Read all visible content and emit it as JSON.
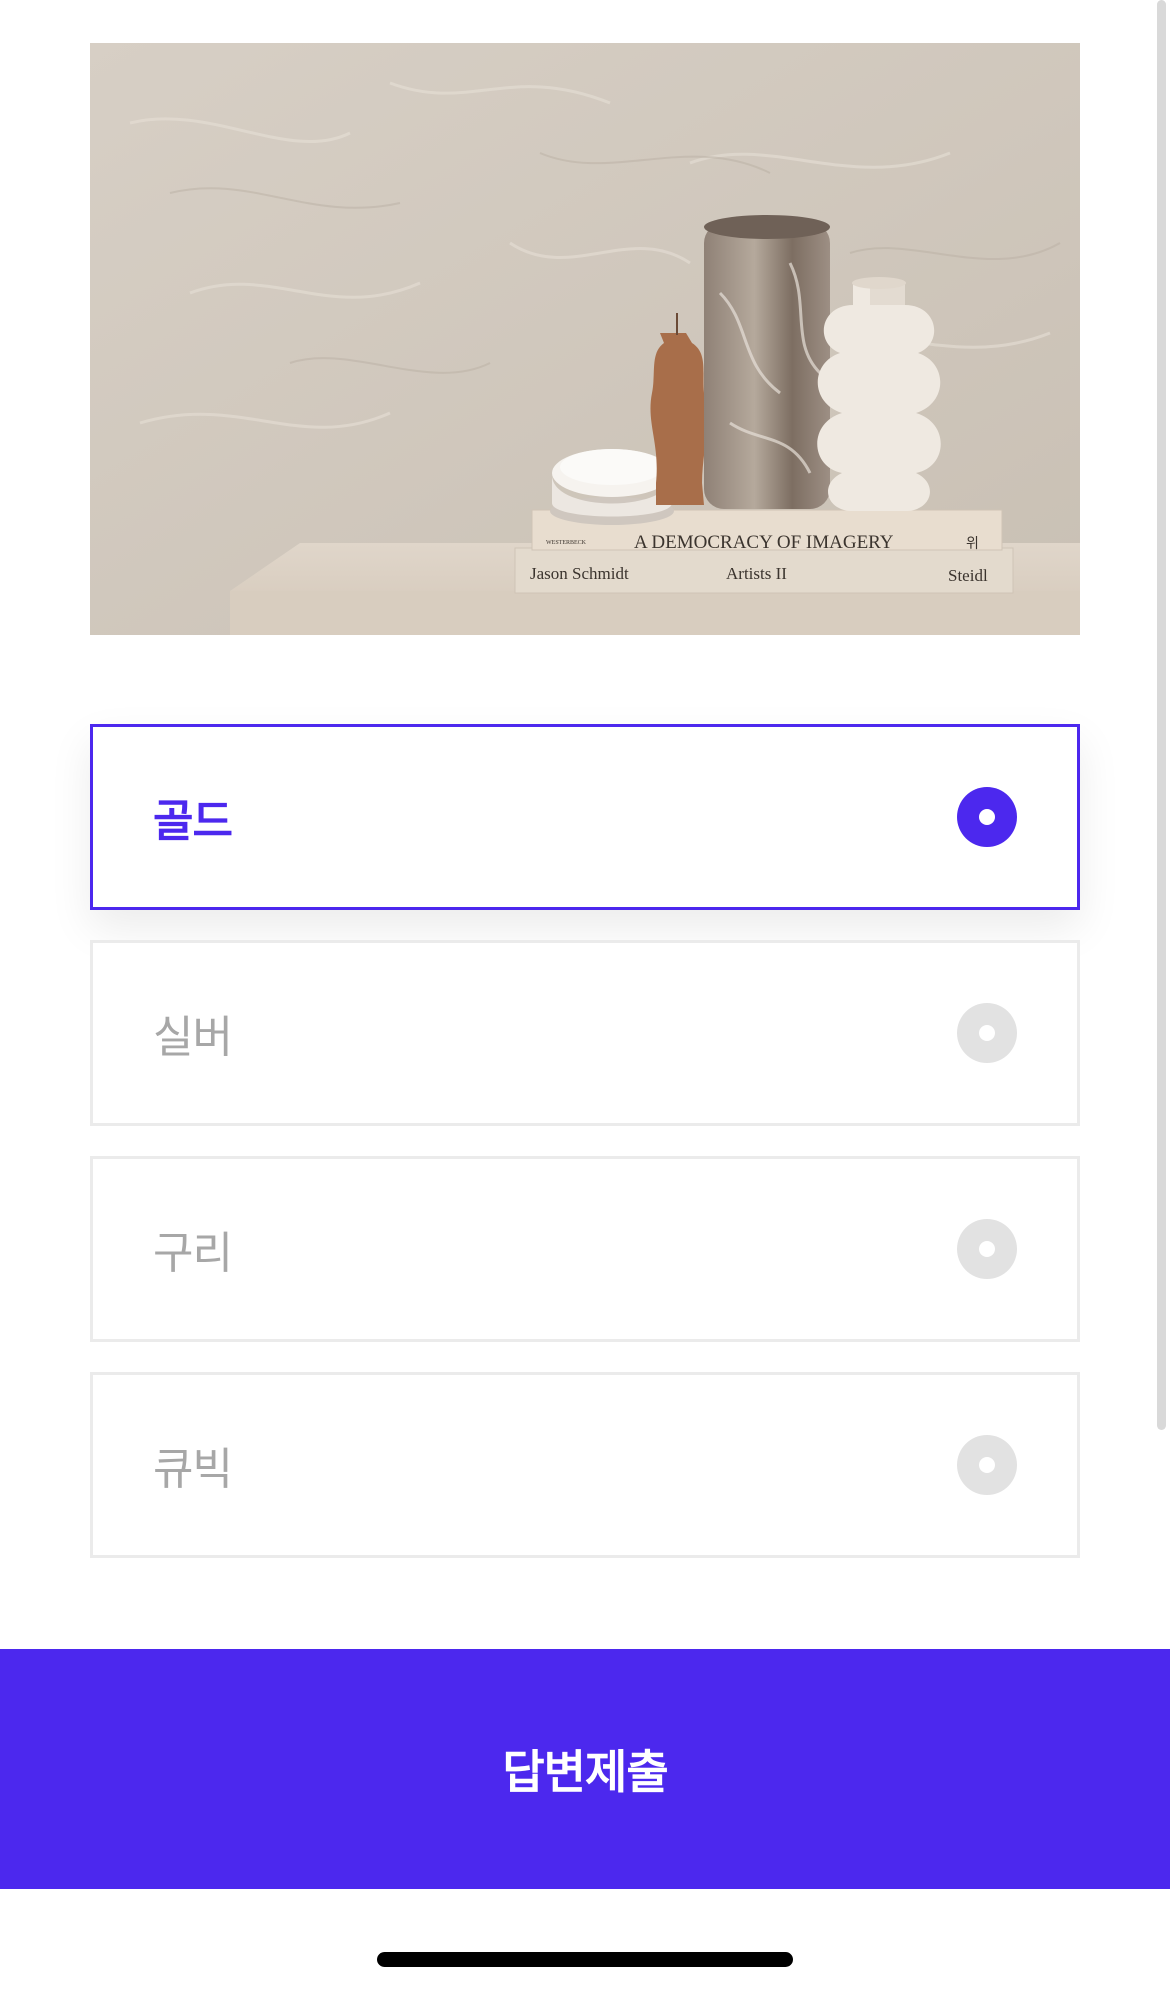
{
  "image": {
    "alt_objects": "book-stack-with-vases",
    "book_top_publisher": "WESTERBECK",
    "book_top_title": "A DEMOCRACY OF IMAGERY",
    "book_top_spine_mark": "위",
    "book_bottom_author": "Jason Schmidt",
    "book_bottom_title": "Artists II",
    "book_bottom_publisher": "Steidl"
  },
  "options": [
    {
      "label": "골드",
      "selected": true
    },
    {
      "label": "실버",
      "selected": false
    },
    {
      "label": "구리",
      "selected": false
    },
    {
      "label": "큐빅",
      "selected": false
    }
  ],
  "submit": {
    "label": "답변제출"
  },
  "colors": {
    "accent": "#4c28ee",
    "unselected_text": "#a7a7a7",
    "unselected_radio": "#e2e2e2",
    "border": "#ebebeb"
  }
}
